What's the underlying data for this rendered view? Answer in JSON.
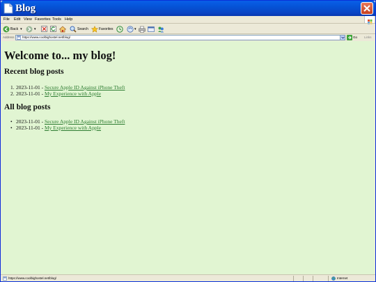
{
  "window": {
    "title": "Blog"
  },
  "menu": {
    "items": [
      "File",
      "Edit",
      "View",
      "Favorites",
      "Tools",
      "Help"
    ]
  },
  "toolbar": {
    "back_label": "Back",
    "search_label": "Search",
    "favorites_label": "Favorites"
  },
  "address": {
    "label": "Address",
    "url": "https://www.coolbighostel.net/blog/",
    "go_label": "Go",
    "links_label": "Links"
  },
  "page": {
    "heading": "Welcome to... my blog!",
    "recent_heading": "Recent blog posts",
    "all_heading": "All blog posts",
    "recent_posts": [
      {
        "marker": "1.",
        "date": "2023-11-01",
        "title": "Secure Apple ID Against iPhone Theft"
      },
      {
        "marker": "2.",
        "date": "2023-11-01",
        "title": "My Experience with Apple"
      }
    ],
    "all_posts": [
      {
        "marker": "•",
        "date": "2023-11-01",
        "title": "Secure Apple ID Against iPhone Theft"
      },
      {
        "marker": "•",
        "date": "2023-11-01",
        "title": "My Experience with Apple"
      }
    ],
    "separator": " - "
  },
  "status": {
    "text": "https://www.coolbighostel.net/blog/",
    "zone": "Internet"
  },
  "colors": {
    "page_background": "#e1f5d2",
    "link": "#2e7d32",
    "titlebar": "#0553d6"
  }
}
